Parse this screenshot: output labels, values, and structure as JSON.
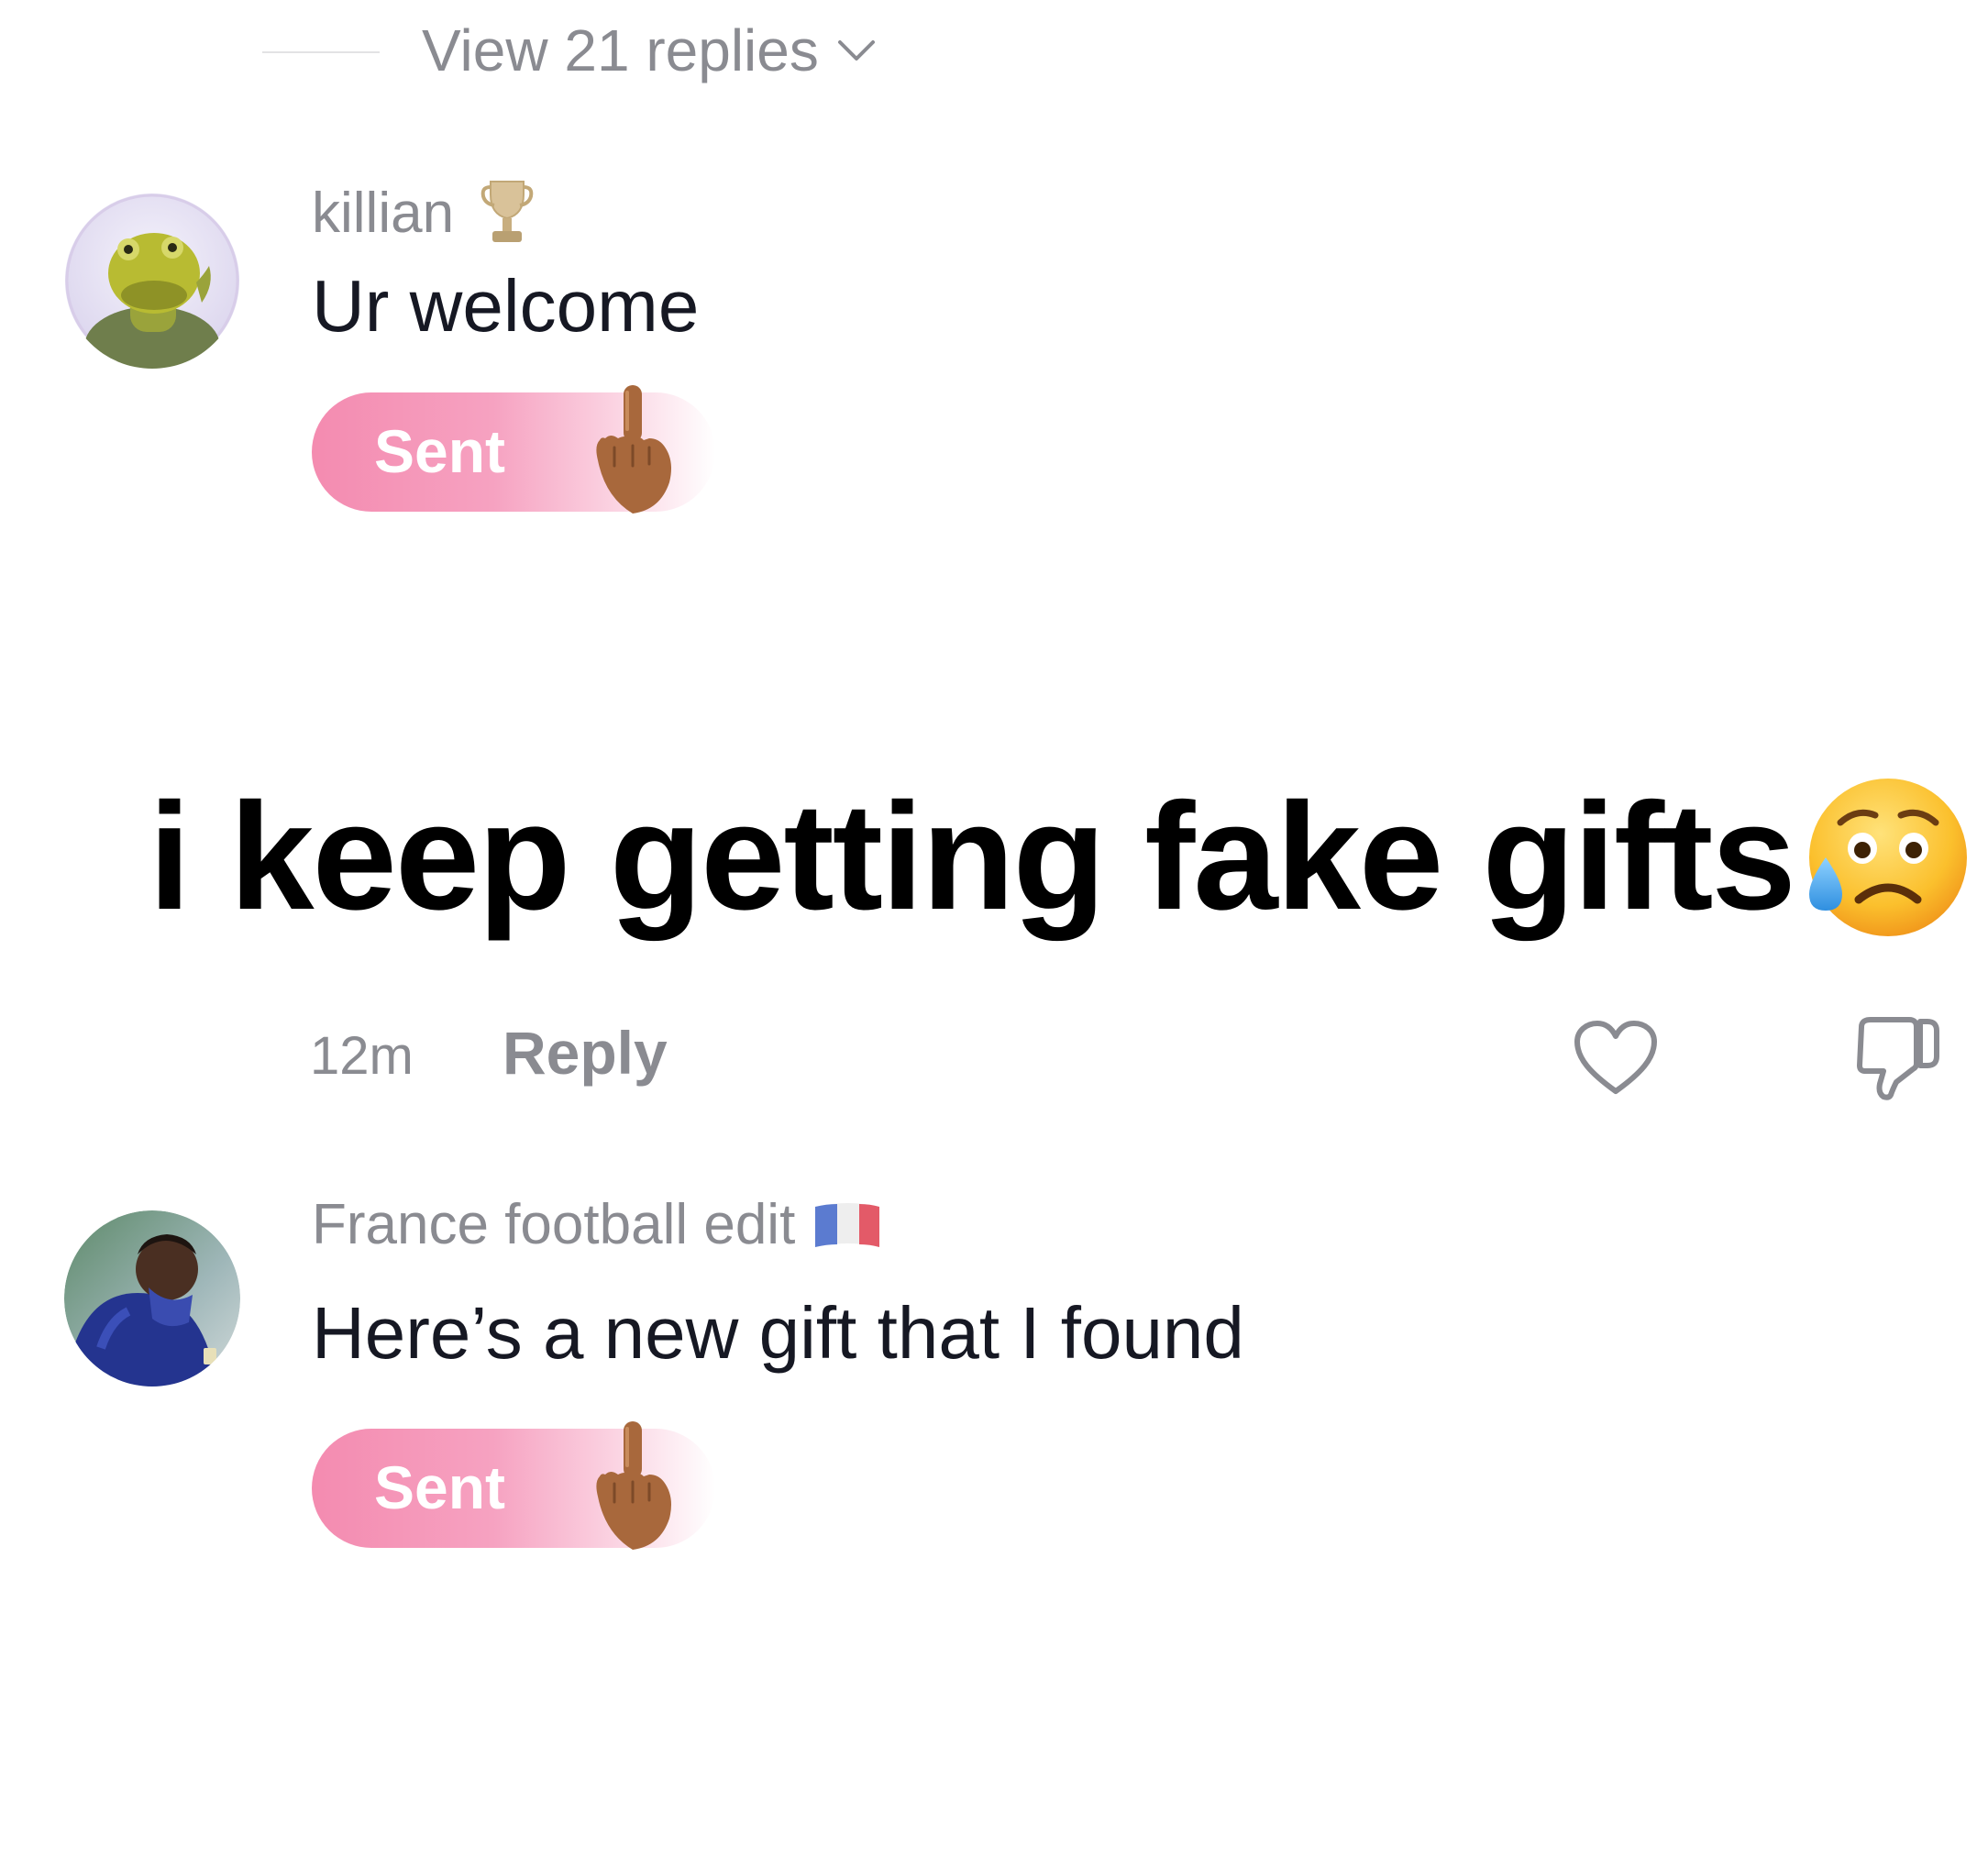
{
  "thread": {
    "view_replies_label": "View 21 replies"
  },
  "comments": [
    {
      "username": "killian",
      "badge_icon": "trophy-icon",
      "text": "Ur welcome",
      "gift_status": "Sent",
      "gift_icon": "middle-finger-emoji"
    },
    {
      "username": "France football edit",
      "badge_icon": "france-flag-icon",
      "text": "Here’s a new gift that I found",
      "gift_status": "Sent",
      "gift_icon": "middle-finger-emoji"
    }
  ],
  "overlay": {
    "caption": "i keep getting fake gifts",
    "emoji": "sad-sweat-face-emoji"
  },
  "meta": {
    "time": "12m",
    "reply_label": "Reply",
    "like_icon": "heart-icon",
    "dislike_icon": "thumbs-down-icon"
  },
  "colors": {
    "secondary_text": "#8a8b91",
    "primary_text": "#161823",
    "gift_pill_pink": "#f48bb0"
  }
}
